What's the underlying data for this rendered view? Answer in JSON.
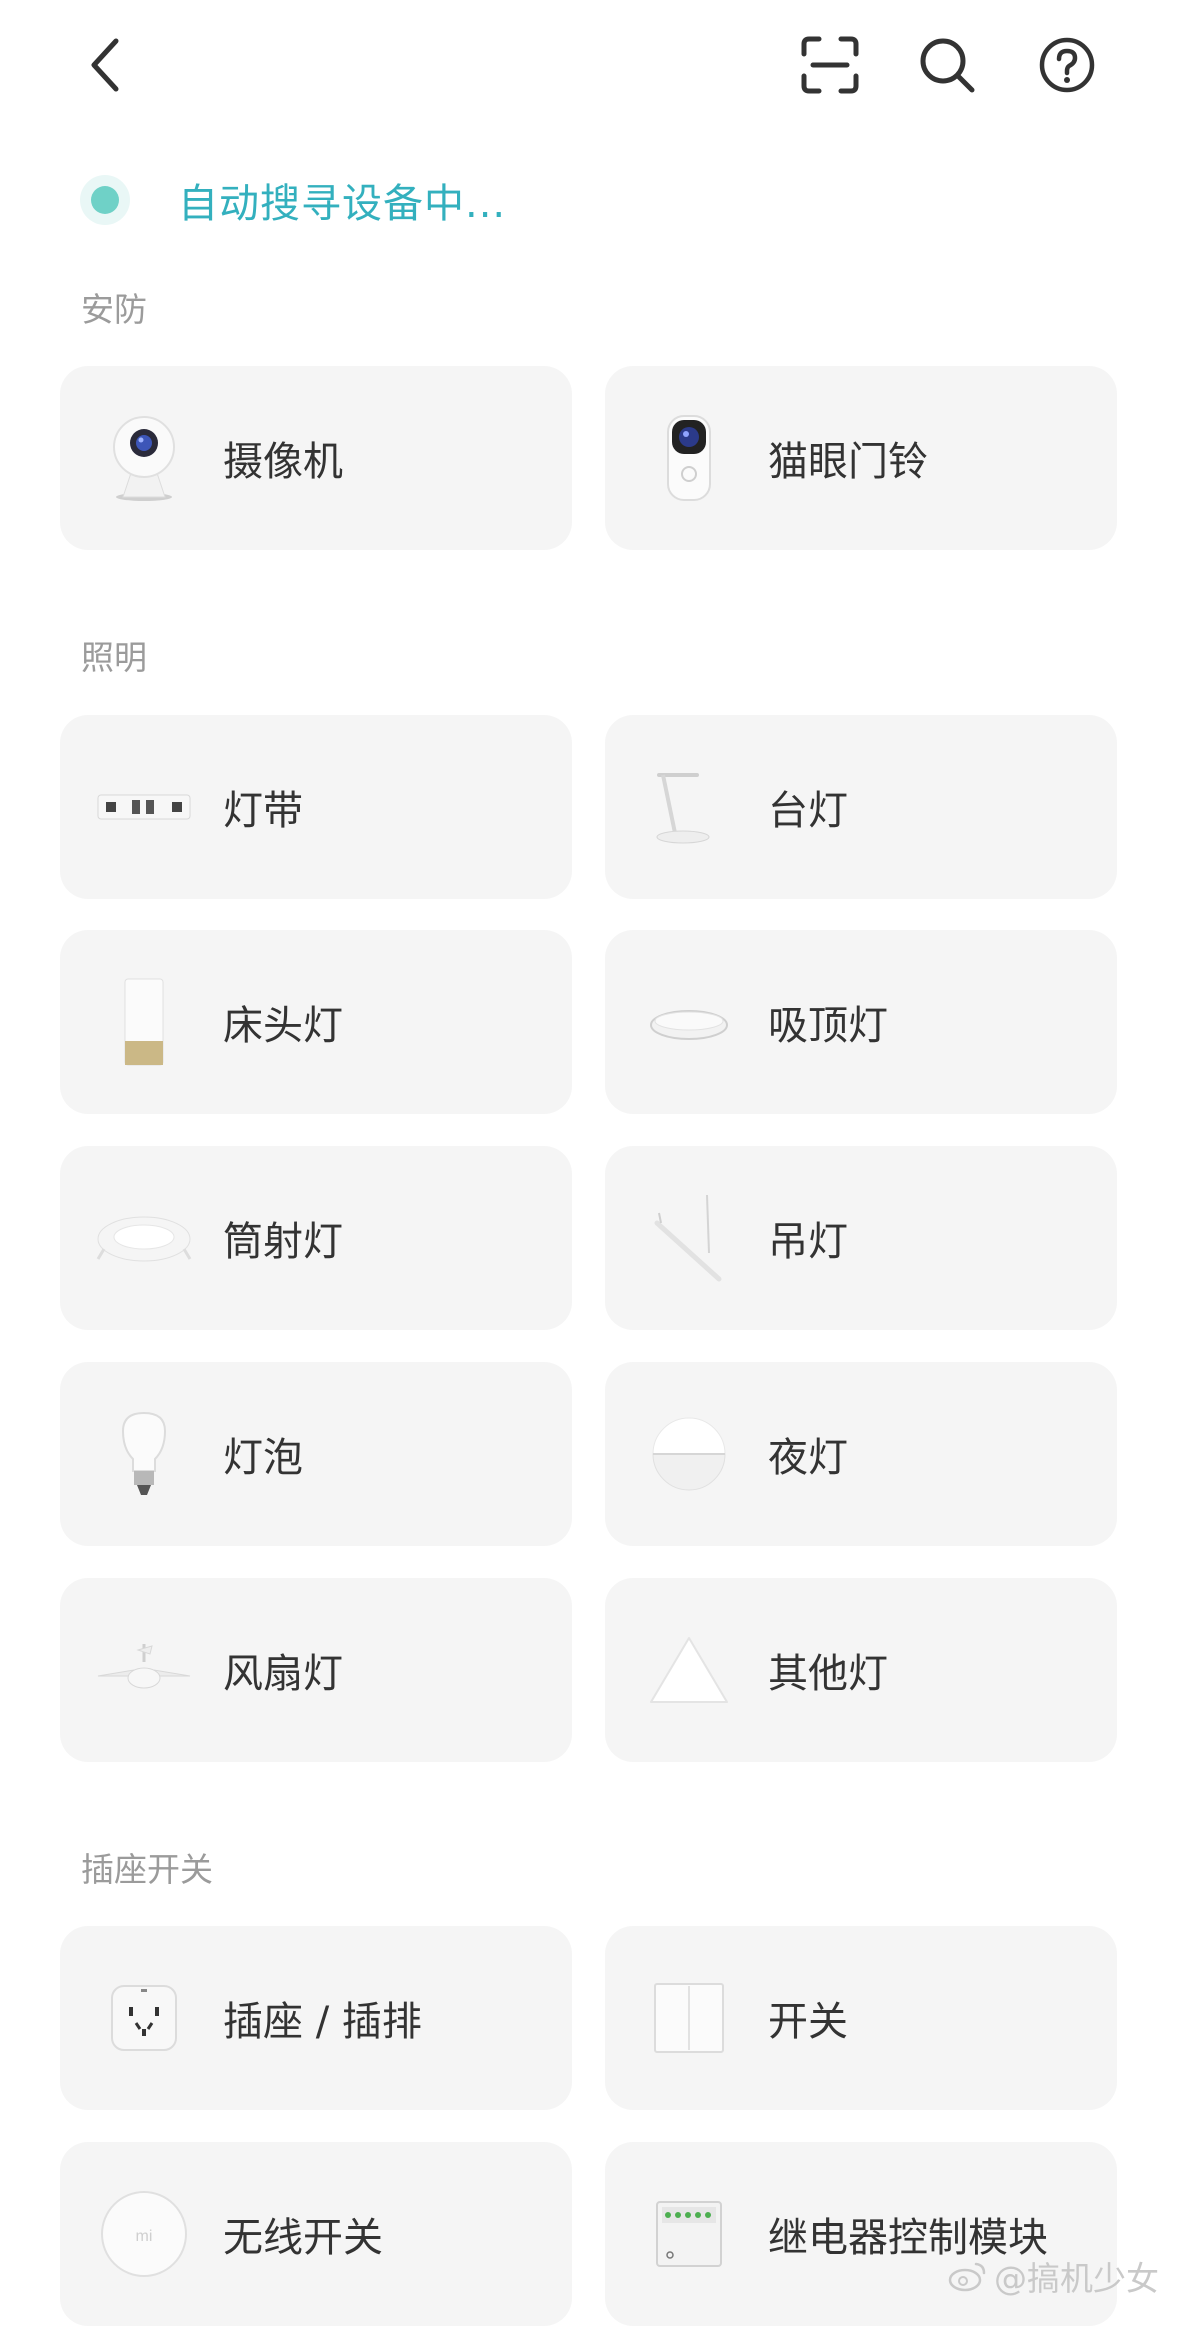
{
  "header": {
    "back_icon": "chevron-left-icon",
    "scan_icon": "scan-icon",
    "search_icon": "search-icon",
    "help_icon": "help-icon"
  },
  "status": {
    "text": "自动搜寻设备中...",
    "color": "#33b0be"
  },
  "sections": {
    "security": {
      "title": "安防",
      "items": [
        {
          "label": "摄像机"
        },
        {
          "label": "猫眼门铃"
        }
      ]
    },
    "lighting": {
      "title": "照明",
      "items": [
        {
          "label": "灯带"
        },
        {
          "label": "台灯"
        },
        {
          "label": "床头灯"
        },
        {
          "label": "吸顶灯"
        },
        {
          "label": "筒射灯"
        },
        {
          "label": "吊灯"
        },
        {
          "label": "灯泡"
        },
        {
          "label": "夜灯"
        },
        {
          "label": "风扇灯"
        },
        {
          "label": "其他灯"
        }
      ]
    },
    "switches": {
      "title": "插座开关",
      "items": [
        {
          "label": "插座 / 插排"
        },
        {
          "label": "开关"
        },
        {
          "label": "无线开关"
        },
        {
          "label": "继电器控制模块"
        }
      ]
    }
  },
  "watermark": {
    "text": "@搞机少女"
  },
  "colors": {
    "accent": "#33b0be",
    "card_bg": "#f5f5f5",
    "section_title": "#9b9b9b"
  }
}
